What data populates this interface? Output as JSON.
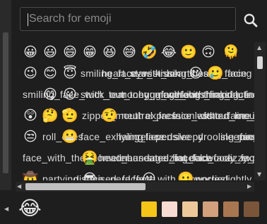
{
  "search": {
    "placeholder": "Search for emoji",
    "value": ""
  },
  "grid": {
    "rows": [
      [
        "😀",
        "😃",
        "😄",
        "😁",
        "😆",
        "😅",
        "🤣",
        "😂",
        "🙂",
        "🙃",
        "🫠"
      ],
      [
        "😉",
        "😊",
        "😇",
        "smiling_face_with_hearts",
        "heart_eyes",
        "star_struck",
        "kissing_heart",
        "☺",
        "kissing_face",
        "🥲",
        "facing"
      ],
      [
        "smiling_face_with_tear",
        "😋",
        "😛",
        "stuck_out_tongue_winking",
        "money_mouth",
        "hugging_face",
        "face_with_hand",
        "shushing_face",
        "thinking_face",
        "saluting_face"
      ],
      [
        "😲",
        "🤔",
        "🫡",
        "zipper_mouth",
        "🤨",
        "neutral_face",
        "expressionless",
        "face_without_mouth",
        "dotted_line_face",
        "face_in_clouds"
      ],
      [
        "😒",
        "roll_eyes",
        "😬",
        "face_exhaling",
        "lying_face",
        "relieved",
        "pensive",
        "sleepy",
        "drooling_face",
        "sleeping",
        "mask"
      ],
      [
        "face_with_thermometer",
        "🤮",
        "head_bandage",
        "nauseated_face",
        "sneezing_face",
        "hot_face",
        "cold_face",
        "woozy_face",
        "dizzy_face",
        "exploding_head"
      ],
      [
        "🤠",
        "partying_face",
        "disguised_face",
        "😎",
        "nerd_face",
        "face_with_monocle",
        "😕",
        "🫤",
        "worried",
        "slightly_frowning"
      ]
    ]
  },
  "footer": {
    "preview_emoji": "😂",
    "tone_colors": [
      "#f5c518",
      "#f6dcd2",
      "#edc99a",
      "#d2a07c",
      "#a87650",
      "#7a5539"
    ]
  },
  "colors": {
    "background": "#1e1e1e",
    "search_border": "#4a4a4a",
    "scroll_thumb": "#d8d8d8"
  },
  "icons": {
    "search": "search-icon",
    "up": "chevron-up-icon",
    "down": "chevron-down-icon",
    "left": "chevron-left-icon",
    "right": "chevron-right-icon"
  }
}
